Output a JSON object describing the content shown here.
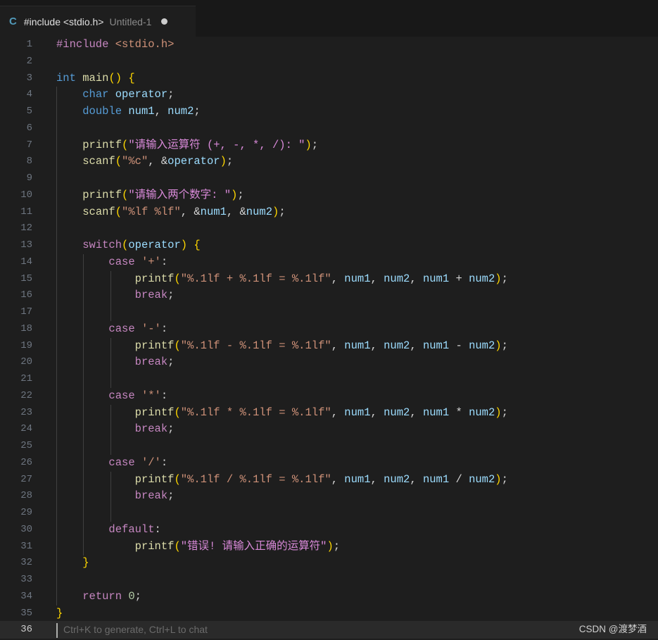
{
  "tab": {
    "lang_icon": "C",
    "title": "#include <stdio.h>",
    "subtitle": "Untitled-1",
    "modified_indicator": "dot-icon"
  },
  "editor": {
    "active_line": "36",
    "lines": [
      {
        "n": "1",
        "text": "#include <stdio.h>"
      },
      {
        "n": "2",
        "text": ""
      },
      {
        "n": "3",
        "text": "int main() {"
      },
      {
        "n": "4",
        "text": "    char operator;"
      },
      {
        "n": "5",
        "text": "    double num1, num2;"
      },
      {
        "n": "6",
        "text": ""
      },
      {
        "n": "7",
        "text": "    printf(\"请输入运算符 (+, -, *, /): \");"
      },
      {
        "n": "8",
        "text": "    scanf(\"%c\", &operator);"
      },
      {
        "n": "9",
        "text": ""
      },
      {
        "n": "10",
        "text": "    printf(\"请输入两个数字: \");"
      },
      {
        "n": "11",
        "text": "    scanf(\"%lf %lf\", &num1, &num2);"
      },
      {
        "n": "12",
        "text": ""
      },
      {
        "n": "13",
        "text": "    switch(operator) {"
      },
      {
        "n": "14",
        "text": "        case '+':"
      },
      {
        "n": "15",
        "text": "            printf(\"%.1lf + %.1lf = %.1lf\", num1, num2, num1 + num2);"
      },
      {
        "n": "16",
        "text": "            break;"
      },
      {
        "n": "17",
        "text": ""
      },
      {
        "n": "18",
        "text": "        case '-':"
      },
      {
        "n": "19",
        "text": "            printf(\"%.1lf - %.1lf = %.1lf\", num1, num2, num1 - num2);"
      },
      {
        "n": "20",
        "text": "            break;"
      },
      {
        "n": "21",
        "text": ""
      },
      {
        "n": "22",
        "text": "        case '*':"
      },
      {
        "n": "23",
        "text": "            printf(\"%.1lf * %.1lf = %.1lf\", num1, num2, num1 * num2);"
      },
      {
        "n": "24",
        "text": "            break;"
      },
      {
        "n": "25",
        "text": ""
      },
      {
        "n": "26",
        "text": "        case '/':"
      },
      {
        "n": "27",
        "text": "            printf(\"%.1lf / %.1lf = %.1lf\", num1, num2, num1 / num2);"
      },
      {
        "n": "28",
        "text": "            break;"
      },
      {
        "n": "29",
        "text": ""
      },
      {
        "n": "30",
        "text": "        default:"
      },
      {
        "n": "31",
        "text": "            printf(\"错误! 请输入正确的运算符\");"
      },
      {
        "n": "32",
        "text": "    }"
      },
      {
        "n": "33",
        "text": ""
      },
      {
        "n": "34",
        "text": "    return 0;"
      },
      {
        "n": "35",
        "text": "}"
      },
      {
        "n": "36",
        "text": ""
      }
    ],
    "ghost_hint": "Ctrl+K to generate, Ctrl+L to chat"
  },
  "watermark": "CSDN @渡梦酒",
  "colors": {
    "background": "#1e1e1e",
    "keyword": "#569cd6",
    "string": "#ce9178",
    "function": "#dcdcaa",
    "control": "#c586c0"
  }
}
